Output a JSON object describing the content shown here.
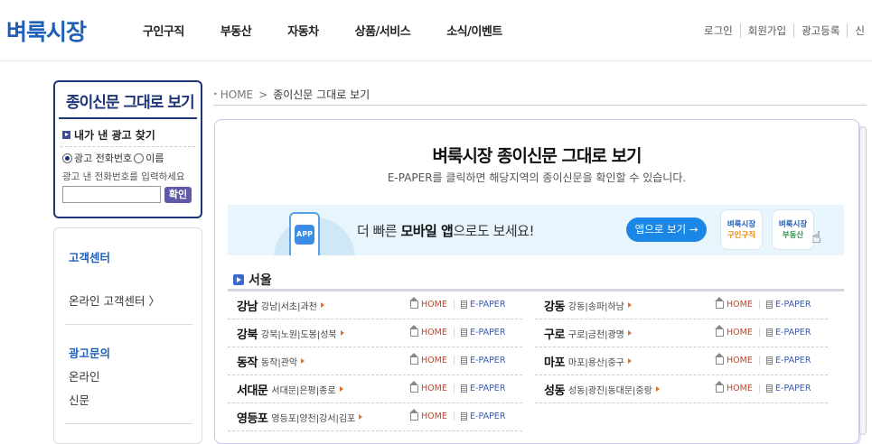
{
  "header": {
    "logo": "벼룩시장",
    "nav": [
      "구인구직",
      "부동산",
      "자동차",
      "상품/서비스",
      "소식/이벤트"
    ],
    "util": [
      "로그인",
      "회원가입",
      "광고등록",
      "신"
    ]
  },
  "paper_box": {
    "title": "종이신문 그대로 보기",
    "find_label": "내가 낸 광고 찾기",
    "radio_phone": "광고 전화번호",
    "radio_name": "이름",
    "hint": "광고 낸 전화번호를 입력하세요",
    "input_placeholder": "",
    "confirm_btn": "확인"
  },
  "customer": {
    "title": "고객센터",
    "online": "온라인 고객센터 〉",
    "ad_title": "광고문의",
    "ad_online": "온라인",
    "ad_paper": "신문"
  },
  "breadcrumb": {
    "home": "HOME",
    "current": "종이신문 그대로 보기"
  },
  "main": {
    "title": "벼룩시장 종이신문 그대로 보기",
    "subtitle": "E-PAPER를 클릭하면 해당지역의 종이신문을 확인할 수 있습니다."
  },
  "banner": {
    "app_icon": "APP",
    "text_pre": "더 빠른 ",
    "text_bold": "모바일 앱",
    "text_post": "으로도 보세요!",
    "button": "앱으로 보기 →",
    "tile_job_1": "벼룩시장",
    "tile_job_2": "구인구직",
    "tile_re_1": "벼룩시장",
    "tile_re_2": "부동산"
  },
  "section": {
    "name": "서울",
    "home_label": "HOME",
    "paper_label": "E-PAPER",
    "regions_left": [
      {
        "name": "강남",
        "sub": "강남|서초|과천"
      },
      {
        "name": "강북",
        "sub": "강북|노원|도봉|성북"
      },
      {
        "name": "동작",
        "sub": "동작|관악"
      },
      {
        "name": "서대문",
        "sub": "서대문|은평|종로"
      },
      {
        "name": "영등포",
        "sub": "영등포|양천|강서|김포"
      }
    ],
    "regions_right": [
      {
        "name": "강동",
        "sub": "강동|송파|하남"
      },
      {
        "name": "구로",
        "sub": "구로|금천|광명"
      },
      {
        "name": "마포",
        "sub": "마포|용산|중구"
      },
      {
        "name": "성동",
        "sub": "성동|광진|동대문|중랑"
      }
    ]
  },
  "colors": {
    "brand": "#1f5fb7",
    "navy": "#1e3678",
    "button_blue": "#1a86e6",
    "home_red": "#c0442a"
  }
}
